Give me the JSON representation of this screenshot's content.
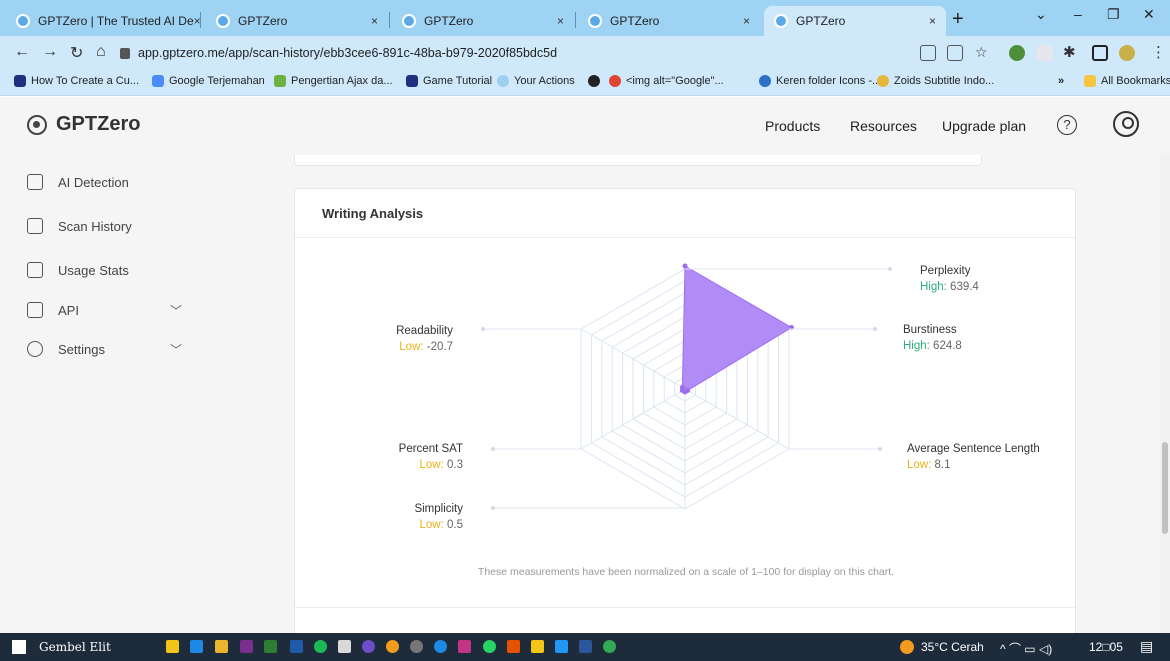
{
  "browser": {
    "tabs": [
      {
        "label": "GPTZero | The Trusted AI De",
        "active": false
      },
      {
        "label": "GPTZero",
        "active": false
      },
      {
        "label": "GPTZero",
        "active": false
      },
      {
        "label": "GPTZero",
        "active": false
      },
      {
        "label": "GPTZero",
        "active": true
      }
    ],
    "tab_close": "×",
    "new_tab": "+",
    "url": "app.gptzero.me/app/scan-history/ebb3cee6-891c-48ba-b979-2020f85bdc5d",
    "bookmarks": [
      "How To Create a Cu...",
      "Google Terjemahan",
      "Pengertian Ajax da...",
      "Game Tutorial",
      "Your Actions",
      "<img alt=\"Google\"...",
      "Keren folder Icons -...",
      "Zoids Subtitle Indo..."
    ],
    "bookmarks_overflow": "»",
    "all_bookmarks": "All Bookmarks"
  },
  "app": {
    "logo": "GPTZero",
    "nav": [
      "Products",
      "Resources",
      "Upgrade plan"
    ],
    "help_glyph": "?",
    "sidebar": [
      {
        "label": "AI Detection",
        "has_chevron": false
      },
      {
        "label": "Scan History",
        "has_chevron": false
      },
      {
        "label": "Usage Stats",
        "has_chevron": false
      },
      {
        "label": "API",
        "has_chevron": true
      },
      {
        "label": "Settings",
        "has_chevron": true
      }
    ],
    "chevron": "﹀"
  },
  "writing_analysis": {
    "title": "Writing Analysis",
    "footnote": "These measurements have been normalized on a scale of 1–100 for display on this chart.",
    "metrics": [
      {
        "name": "Perplexity",
        "level": "High",
        "value": "639.4"
      },
      {
        "name": "Burstiness",
        "level": "High",
        "value": "624.8"
      },
      {
        "name": "Average Sentence Length",
        "level": "Low",
        "value": "8.1"
      },
      {
        "name": "Simplicity",
        "level": "Low",
        "value": "0.5"
      },
      {
        "name": "Percent SAT",
        "level": "Low",
        "value": "0.3"
      },
      {
        "name": "Readability",
        "level": "Low",
        "value": "-20.7"
      }
    ],
    "level_separator": ": "
  },
  "chart_data": {
    "type": "radar",
    "categories": [
      "Perplexity",
      "Burstiness",
      "Average Sentence Length",
      "Simplicity",
      "Percent SAT",
      "Readability"
    ],
    "values_normalized": [
      100,
      100,
      1,
      1,
      1,
      1
    ],
    "range": [
      1,
      100
    ],
    "fill_color": "#b18cf7",
    "grid_color": "#dbe5f1"
  },
  "taskbar": {
    "user": "Gembel Elit",
    "weather": "35°C  Cerah",
    "clock": "12□05",
    "tray": "^  ⌒ ▭ ◁)"
  },
  "colors": {
    "high": "#2fae7d",
    "low": "#e8b21a",
    "tab_strip": "#9fd3f4",
    "chrome": "#cfe9fb"
  }
}
